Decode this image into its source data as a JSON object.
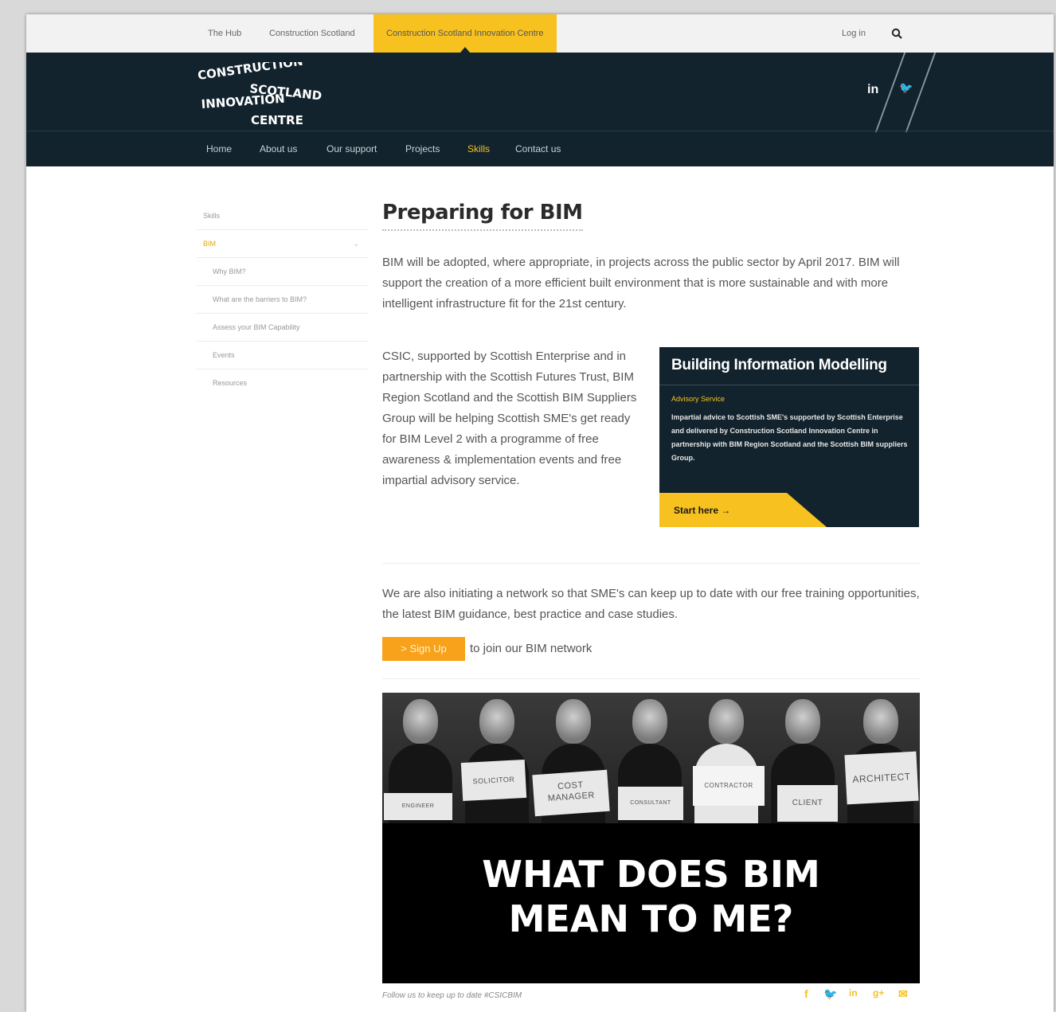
{
  "topbar": {
    "links": [
      "The Hub",
      "Construction Scotland",
      "Construction Scotland Innovation Centre"
    ],
    "login": "Log in"
  },
  "header": {
    "logo_lines": [
      "CONSTRUCTION",
      "SCOTLAND",
      "INNOVATION",
      "CENTRE"
    ],
    "social": {
      "linkedin": "in",
      "twitter": "🐦"
    },
    "nav": [
      "Home",
      "About us",
      "Our support",
      "Projects",
      "Skills",
      "Contact us"
    ],
    "nav_active": "Skills"
  },
  "sidebar": {
    "items": [
      "Skills",
      "BIM",
      "Why BIM?",
      "What are the barriers to BIM?",
      "Assess your BIM Capability",
      "Events",
      "Resources"
    ]
  },
  "main": {
    "title": "Preparing for BIM",
    "p1": "BIM will be adopted, where appropriate, in projects across the public sector by April 2017. BIM will support the creation of a more efficient built environment that is more sustainable and with more intelligent infrastructure fit for the 21st century.",
    "p2": "CSIC, supported by Scottish Enterprise and in partnership with the Scottish Futures Trust, BIM Region Scotland and the Scottish BIM Suppliers Group will be helping Scottish SME's get ready for BIM Level 2 with a programme of free awareness & implementation events and free impartial advisory service.",
    "p3": "We are also initiating a network so that SME's can keep up to date with our free training opportunities, the latest BIM guidance, best practice and case studies.",
    "signup_label": "> Sign Up",
    "signup_tail": "to join our BIM network"
  },
  "card": {
    "title": "Building Information Modelling",
    "subtitle": "Advisory Service",
    "body": "Impartial advice to Scottish SME's supported by Scottish Enterprise and delivered by Construction Scotland Innovation Centre in partnership with BIM Region Scotland and the Scottish BIM suppliers Group.",
    "cta": "Start here →"
  },
  "banner": {
    "signs": [
      "ENGINEER",
      "SOLICITOR",
      "COST MANAGER",
      "CONSULTANT",
      "CONTRACTOR",
      "CLIENT",
      "ARCHITECT"
    ],
    "headline_1": "WHAT DOES BIM",
    "headline_2": "MEAN TO ME?"
  },
  "footer": {
    "caption": "Follow us to keep up to date #CSICBIM",
    "share_icons": [
      "facebook-icon",
      "twitter-icon",
      "linkedin-icon",
      "google-plus-icon",
      "email-icon"
    ]
  },
  "colors": {
    "accent": "#f7c21f",
    "navy": "#12232d",
    "signup": "#f7a21a"
  }
}
